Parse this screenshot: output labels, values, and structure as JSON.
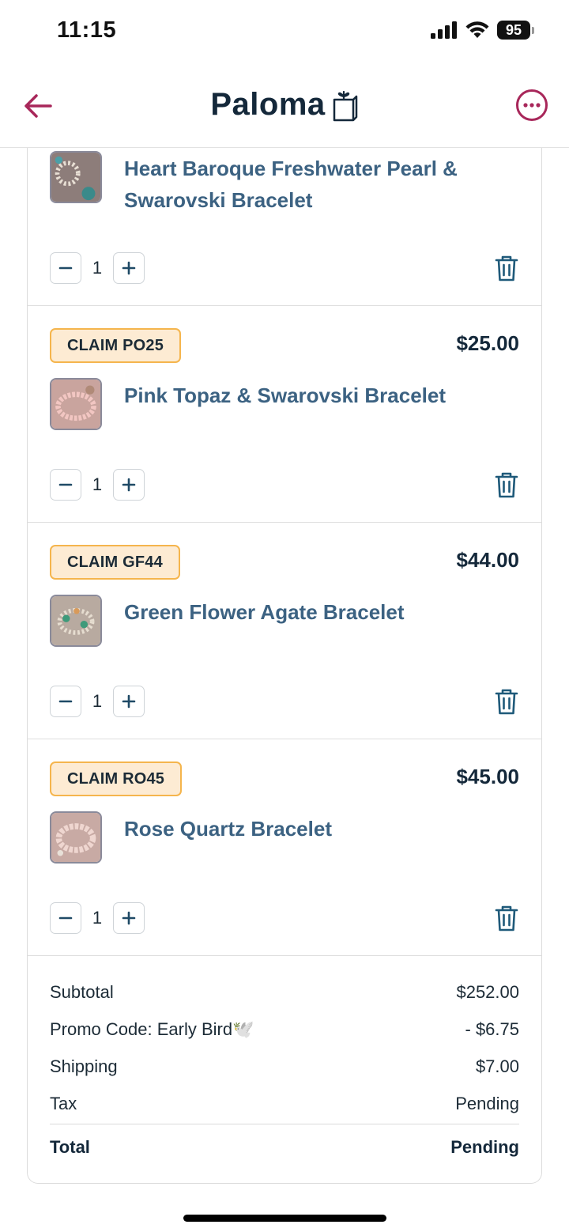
{
  "status_bar": {
    "time": "11:15",
    "battery": "95"
  },
  "header": {
    "brand": "Paloma"
  },
  "cart": {
    "items": [
      {
        "claim": "",
        "price": "",
        "title": "Heart Baroque Freshwater Pearl & Swarovski Bracelet",
        "quantity": "1",
        "thumb_color": "#9b8a86"
      },
      {
        "claim": "CLAIM PO25",
        "price": "$25.00",
        "title": "Pink Topaz & Swarovski Bracelet",
        "quantity": "1",
        "thumb_color": "#d9a7a0"
      },
      {
        "claim": "CLAIM GF44",
        "price": "$44.00",
        "title": "Green Flower Agate Bracelet",
        "quantity": "1",
        "thumb_color": "#8aa89a"
      },
      {
        "claim": "CLAIM RO45",
        "price": "$45.00",
        "title": "Rose Quartz Bracelet",
        "quantity": "1",
        "thumb_color": "#d8b8b0"
      }
    ]
  },
  "summary": {
    "subtotal_label": "Subtotal",
    "subtotal_value": "$252.00",
    "promo_label": "Promo Code: Early Bird🕊️",
    "promo_value": "- $6.75",
    "shipping_label": "Shipping",
    "shipping_value": "$7.00",
    "tax_label": "Tax",
    "tax_value": "Pending",
    "total_label": "Total",
    "total_value": "Pending"
  },
  "colors": {
    "accent": "#a8275a",
    "brand_text": "#14283a",
    "link": "#3c6282",
    "badge_bg": "#fdebd3",
    "badge_border": "#f5b54d"
  }
}
